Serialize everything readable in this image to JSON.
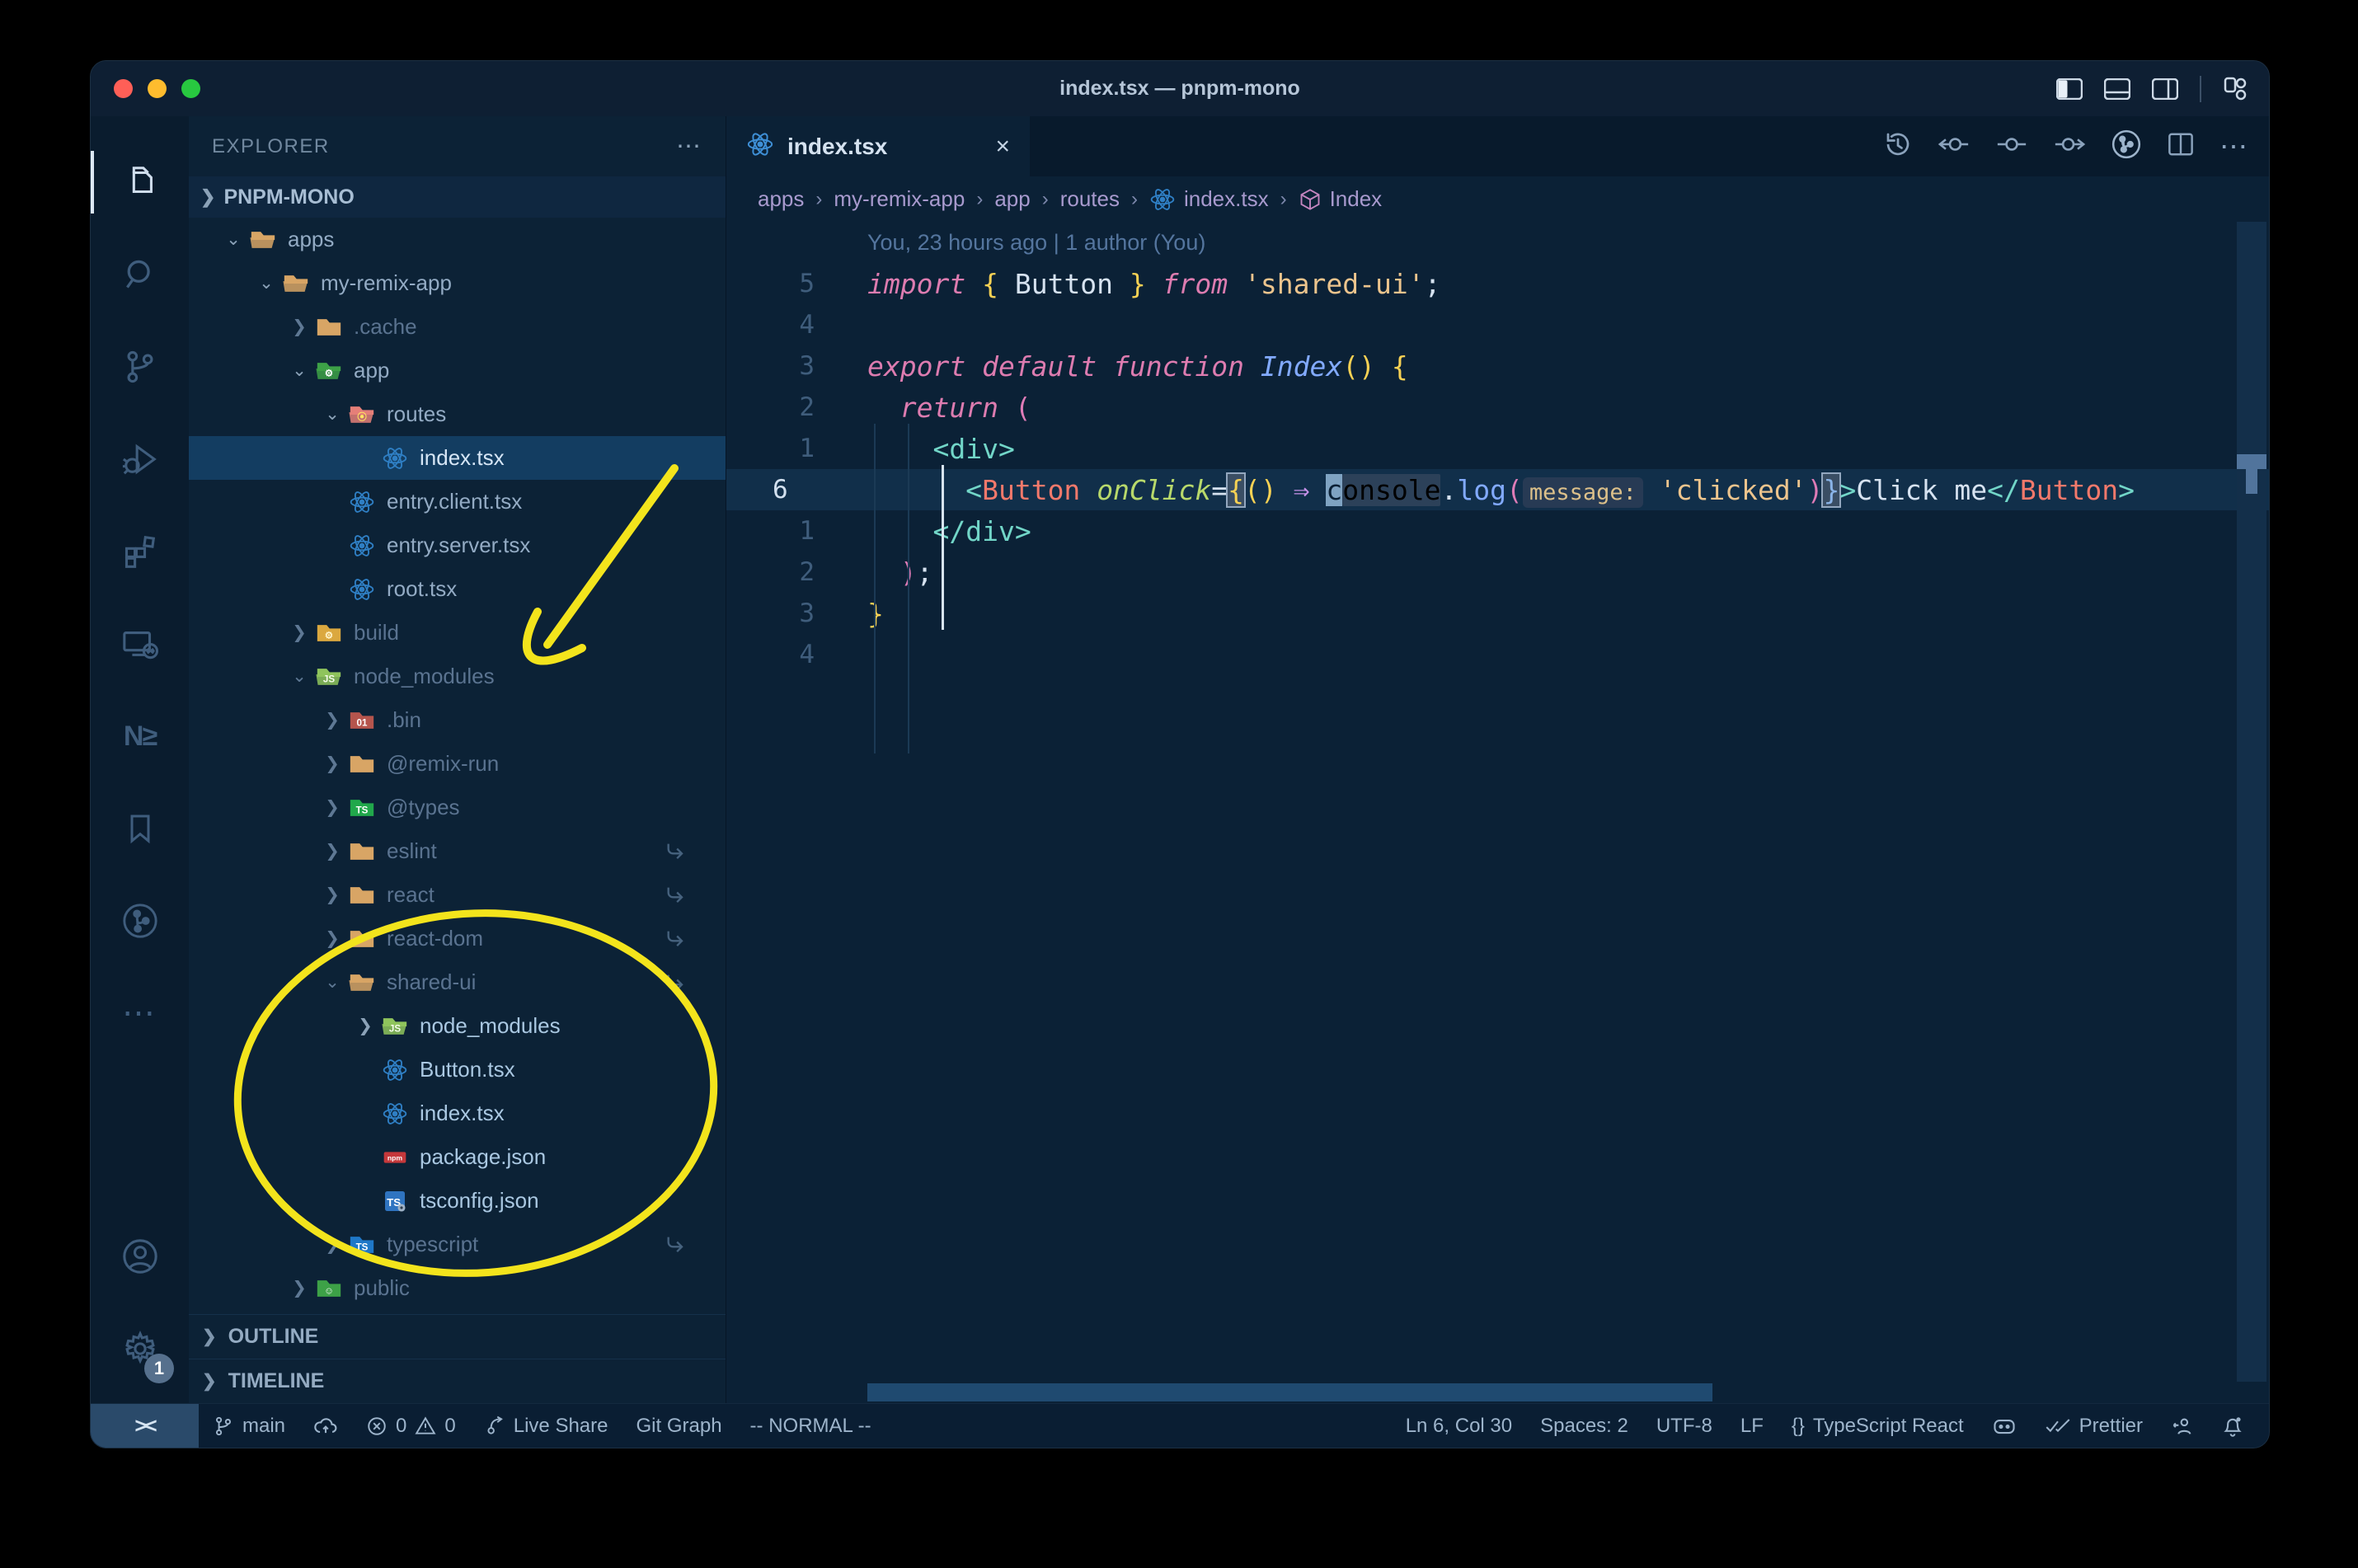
{
  "window": {
    "title": "index.tsx — pnpm-mono"
  },
  "activity_bar": {
    "items": [
      {
        "name": "explorer",
        "icon": "files",
        "active": true
      },
      {
        "name": "search",
        "icon": "search",
        "active": false
      },
      {
        "name": "source-control",
        "icon": "branch-big",
        "active": false
      },
      {
        "name": "run-debug",
        "icon": "debug",
        "active": false
      },
      {
        "name": "extensions",
        "icon": "extensions",
        "active": false
      },
      {
        "name": "remote-explorer",
        "icon": "remote",
        "active": false
      },
      {
        "name": "nx-console",
        "icon": "nx",
        "active": false
      },
      {
        "name": "bookmarks",
        "icon": "bookmark",
        "active": false
      },
      {
        "name": "gitlens",
        "icon": "gitlens",
        "active": false
      },
      {
        "name": "more-views",
        "icon": "ellipsis",
        "active": false
      }
    ],
    "bottom": [
      {
        "name": "account",
        "icon": "account"
      },
      {
        "name": "settings",
        "icon": "gear",
        "badge": "1"
      }
    ]
  },
  "explorer": {
    "title": "EXPLORER",
    "section": "PNPM-MONO",
    "outline_label": "OUTLINE",
    "timeline_label": "TIMELINE",
    "items": [
      {
        "label": "apps",
        "level": 1,
        "chevron": "v",
        "icon": "folder-open"
      },
      {
        "label": "my-remix-app",
        "level": 2,
        "chevron": "v",
        "icon": "folder-open"
      },
      {
        "label": ".cache",
        "level": 3,
        "chevron": ">",
        "icon": "folder",
        "dim": true
      },
      {
        "label": "app",
        "level": 3,
        "chevron": "v",
        "icon": "folder-app"
      },
      {
        "label": "routes",
        "level": 4,
        "chevron": "v",
        "icon": "folder-routes"
      },
      {
        "label": "index.tsx",
        "level": 5,
        "chevron": "",
        "icon": "react",
        "selected": true
      },
      {
        "label": "entry.client.tsx",
        "level": 4,
        "chevron": "",
        "icon": "react"
      },
      {
        "label": "entry.server.tsx",
        "level": 4,
        "chevron": "",
        "icon": "react"
      },
      {
        "label": "root.tsx",
        "level": 4,
        "chevron": "",
        "icon": "react"
      },
      {
        "label": "build",
        "level": 3,
        "chevron": ">",
        "icon": "folder-build",
        "dim": true
      },
      {
        "label": "node_modules",
        "level": 3,
        "chevron": "v",
        "icon": "folder-node",
        "dim": true
      },
      {
        "label": ".bin",
        "level": 4,
        "chevron": ">",
        "icon": "folder-bin",
        "dim": true
      },
      {
        "label": "@remix-run",
        "level": 4,
        "chevron": ">",
        "icon": "folder",
        "dim": true
      },
      {
        "label": "@types",
        "level": 4,
        "chevron": ">",
        "icon": "folder-types",
        "dim": true
      },
      {
        "label": "eslint",
        "level": 4,
        "chevron": ">",
        "icon": "folder",
        "dim": true,
        "symlink": true
      },
      {
        "label": "react",
        "level": 4,
        "chevron": ">",
        "icon": "folder",
        "dim": true,
        "symlink": true
      },
      {
        "label": "react-dom",
        "level": 4,
        "chevron": ">",
        "icon": "folder",
        "dim": true,
        "symlink": true
      },
      {
        "label": "shared-ui",
        "level": 4,
        "chevron": "v",
        "icon": "folder-open",
        "dim": true,
        "symlink": true
      },
      {
        "label": "node_modules",
        "level": 5,
        "chevron": ">",
        "icon": "folder-node",
        "bright": true
      },
      {
        "label": "Button.tsx",
        "level": 5,
        "chevron": "",
        "icon": "react",
        "bright": true
      },
      {
        "label": "index.tsx",
        "level": 5,
        "chevron": "",
        "icon": "react",
        "bright": true
      },
      {
        "label": "package.json",
        "level": 5,
        "chevron": "",
        "icon": "npm",
        "bright": true
      },
      {
        "label": "tsconfig.json",
        "level": 5,
        "chevron": "",
        "icon": "tsconfig",
        "bright": true
      },
      {
        "label": "typescript",
        "level": 4,
        "chevron": ">",
        "icon": "folder-ts",
        "dim": true,
        "symlink": true
      },
      {
        "label": "public",
        "level": 3,
        "chevron": ">",
        "icon": "folder-public",
        "dim": true
      }
    ]
  },
  "tab": {
    "label": "index.tsx",
    "close": "×"
  },
  "breadcrumbs": [
    {
      "label": "apps"
    },
    {
      "label": "my-remix-app"
    },
    {
      "label": "app"
    },
    {
      "label": "routes"
    },
    {
      "label": "index.tsx",
      "icon": "react"
    },
    {
      "label": "Index",
      "icon": "symbol-class"
    }
  ],
  "editor": {
    "blame": "You, 23 hours ago | 1 author (You)",
    "lines": [
      {
        "num": "5",
        "tokens": [
          {
            "t": "import",
            "s": "kw"
          },
          {
            "t": " ",
            "s": "id"
          },
          {
            "t": "{",
            "s": "y"
          },
          {
            "t": " Button ",
            "s": "id"
          },
          {
            "t": "}",
            "s": "y"
          },
          {
            "t": " ",
            "s": "id"
          },
          {
            "t": "from",
            "s": "kw"
          },
          {
            "t": " ",
            "s": "id"
          },
          {
            "t": "'shared-ui'",
            "s": "str"
          },
          {
            "t": ";",
            "s": "id"
          }
        ]
      },
      {
        "num": "4",
        "tokens": []
      },
      {
        "num": "3",
        "tokens": [
          {
            "t": "export default function",
            "s": "kw"
          },
          {
            "t": " ",
            "s": "id"
          },
          {
            "t": "Index",
            "s": "fni"
          },
          {
            "t": "()",
            "s": "y"
          },
          {
            "t": " ",
            "s": "id"
          },
          {
            "t": "{",
            "s": "y"
          }
        ]
      },
      {
        "num": "2",
        "tokens": [
          {
            "t": "  ",
            "s": "id"
          },
          {
            "t": "return",
            "s": "kw"
          },
          {
            "t": " ",
            "s": "id"
          },
          {
            "t": "(",
            "s": "p"
          }
        ]
      },
      {
        "num": "1",
        "tokens": [
          {
            "t": "    ",
            "s": "id"
          },
          {
            "t": "<div>",
            "s": "angle"
          }
        ]
      },
      {
        "num": "6",
        "current": true,
        "tokens": [
          {
            "t": "      ",
            "s": "id"
          },
          {
            "t": "<",
            "s": "angle"
          },
          {
            "t": "Button",
            "s": "tag"
          },
          {
            "t": " ",
            "s": "id"
          },
          {
            "t": "onClick",
            "s": "attr"
          },
          {
            "t": "=",
            "s": "id"
          },
          {
            "t": "{",
            "s": "ybox"
          },
          {
            "t": "()",
            "s": "y"
          },
          {
            "t": " ",
            "s": "id"
          },
          {
            "t": "⇒",
            "s": "arrow"
          },
          {
            "t": " ",
            "s": "id"
          },
          {
            "t": "c",
            "s": "cursor"
          },
          {
            "t": "onsole",
            "s": "whl"
          },
          {
            "t": ".",
            "s": "id"
          },
          {
            "t": "log",
            "s": "fn"
          },
          {
            "t": "(",
            "s": "p"
          },
          {
            "t": "message:",
            "s": "inlay"
          },
          {
            "t": " ",
            "s": "id"
          },
          {
            "t": "'clicked'",
            "s": "str"
          },
          {
            "t": ")",
            "s": "p"
          },
          {
            "t": "}",
            "s": "bbox"
          },
          {
            "t": ">",
            "s": "angle"
          },
          {
            "t": "Click me",
            "s": "id"
          },
          {
            "t": "</",
            "s": "angle"
          },
          {
            "t": "Button",
            "s": "tag"
          },
          {
            "t": ">",
            "s": "angle"
          }
        ]
      },
      {
        "num": "1",
        "tokens": [
          {
            "t": "    ",
            "s": "id"
          },
          {
            "t": "</div>",
            "s": "angle"
          }
        ]
      },
      {
        "num": "2",
        "tokens": [
          {
            "t": "  ",
            "s": "id"
          },
          {
            "t": ")",
            "s": "p"
          },
          {
            "t": ";",
            "s": "id"
          }
        ]
      },
      {
        "num": "3",
        "tokens": [
          {
            "t": "}",
            "s": "y"
          }
        ]
      },
      {
        "num": "4",
        "tokens": []
      }
    ]
  },
  "status_bar": {
    "left": [
      {
        "name": "branch",
        "icon": "branch",
        "label": "main"
      },
      {
        "name": "sync",
        "icon": "cloud-upload",
        "label": ""
      },
      {
        "name": "problems",
        "parts": [
          {
            "icon": "error",
            "label": "0"
          },
          {
            "icon": "warning",
            "label": "0"
          }
        ]
      },
      {
        "name": "live-share",
        "icon": "share",
        "label": "Live Share"
      },
      {
        "name": "git-graph",
        "label": "Git Graph"
      },
      {
        "name": "vim-mode",
        "label": "-- NORMAL --"
      }
    ],
    "remote_glyph": "><",
    "right": [
      {
        "name": "cursor-position",
        "label": "Ln 6, Col 30"
      },
      {
        "name": "indentation",
        "label": "Spaces: 2"
      },
      {
        "name": "encoding",
        "label": "UTF-8"
      },
      {
        "name": "eol",
        "label": "LF"
      },
      {
        "name": "language-mode",
        "icon": "braces",
        "label": "TypeScript React"
      },
      {
        "name": "copilot",
        "icon": "copilot",
        "label": ""
      },
      {
        "name": "formatter",
        "icon": "double-check",
        "label": "Prettier"
      },
      {
        "name": "liveshare-contact",
        "icon": "person",
        "label": ""
      },
      {
        "name": "notifications",
        "icon": "bell",
        "label": ""
      }
    ]
  },
  "annotations": {
    "color": "#f3e41c"
  },
  "colors": {
    "editor_bg": "#0b2136",
    "sidebar_bg": "#0c2236",
    "activitybar_bg": "#0a1c2e",
    "titlebar_bg": "#0e1f33",
    "statusbar_bg": "#0a1e33",
    "selection_row": "#133d61",
    "current_line": "#112f4a",
    "annotation_yellow": "#f3e41c"
  }
}
